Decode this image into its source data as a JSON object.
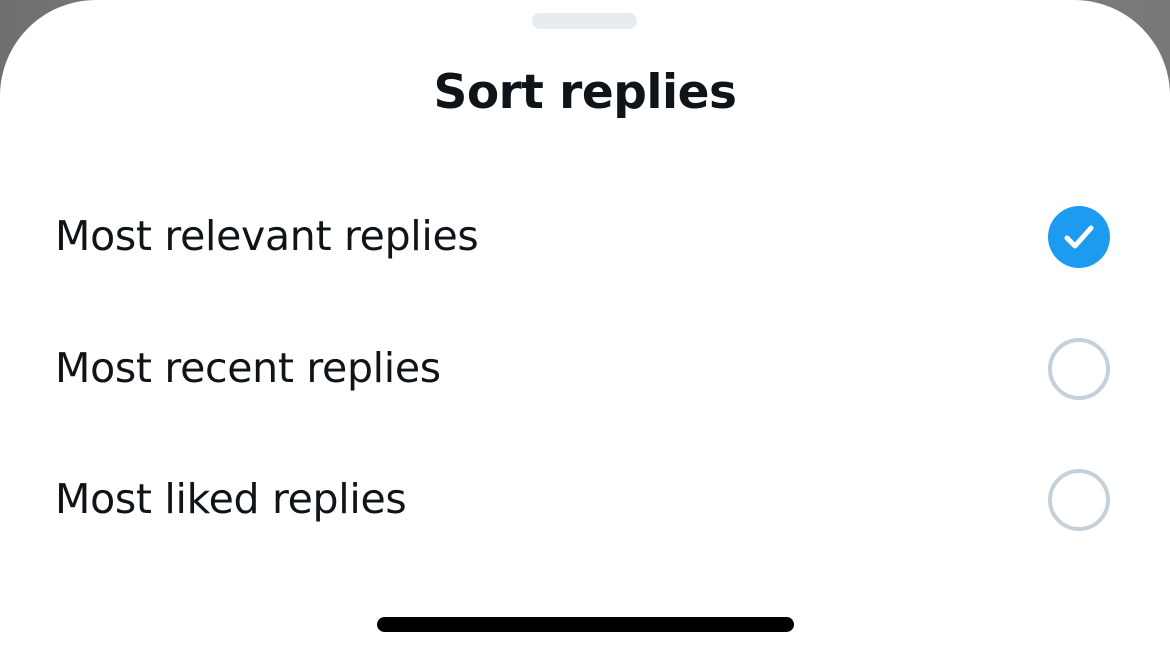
{
  "sheet": {
    "title": "Sort replies",
    "options": [
      {
        "label": "Most relevant replies",
        "selected": true
      },
      {
        "label": "Most recent replies",
        "selected": false
      },
      {
        "label": "Most liked replies",
        "selected": false
      }
    ]
  },
  "colors": {
    "accent": "#1d9bf0",
    "text": "#0f1419",
    "radio_border": "#c5d0d8"
  },
  "icons": {
    "selected": "check-circle-icon",
    "unselected": "empty-circle-icon"
  }
}
